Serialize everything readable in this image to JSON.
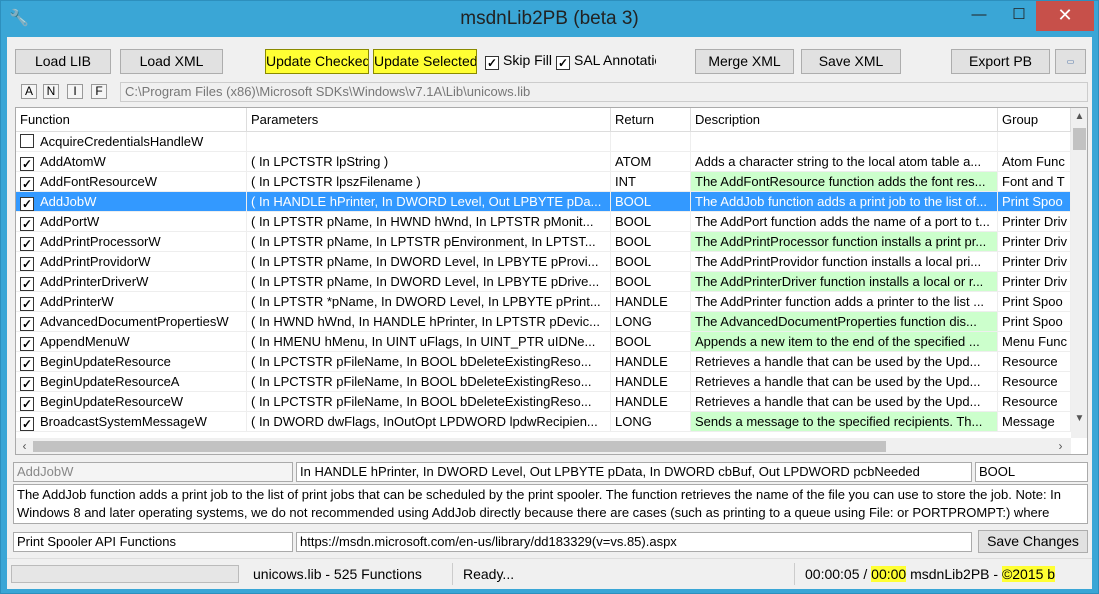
{
  "window": {
    "title": "msdnLib2PB (beta 3)",
    "min_glyph": "—",
    "max_glyph": "☐",
    "close_glyph": "✕"
  },
  "toolbar": {
    "load_lib": "Load LIB",
    "load_xml": "Load XML",
    "update_checked": "Update Checked",
    "update_selected": "Update Selected",
    "skip_fill": "Skip Fill",
    "sal_annotations": "SAL Annotatic",
    "merge_xml": "Merge XML",
    "save_xml": "Save XML",
    "export_pb": "Export PB",
    "highlight_color": "#ffff33"
  },
  "filters": [
    "A",
    "N",
    "I",
    "F"
  ],
  "path": "C:\\Program Files (x86)\\Microsoft SDKs\\Windows\\v7.1A\\Lib\\unicows.lib",
  "grid": {
    "columns": [
      "Function",
      "Parameters",
      "Return",
      "Description",
      "Group"
    ],
    "rows": [
      {
        "checked": false,
        "function": "AcquireCredentialsHandleW",
        "params": "",
        "ret": "",
        "desc": "",
        "group": "",
        "green": false,
        "selected": false
      },
      {
        "checked": true,
        "function": "AddAtomW",
        "params": "( In LPCTSTR lpString )",
        "ret": "ATOM",
        "desc": "Adds a character string to the local atom table a...",
        "group": "Atom Func",
        "green": false,
        "selected": false
      },
      {
        "checked": true,
        "function": "AddFontResourceW",
        "params": "( In LPCTSTR lpszFilename )",
        "ret": "INT",
        "desc": "The AddFontResource function adds the font res...",
        "group": "Font and T",
        "green": true,
        "selected": false
      },
      {
        "checked": true,
        "function": "AddJobW",
        "params": "( In HANDLE hPrinter, In DWORD Level, Out LPBYTE pDa...",
        "ret": "BOOL",
        "desc": "The AddJob function adds a print job to the list of...",
        "group": "Print Spoo",
        "green": true,
        "selected": true
      },
      {
        "checked": true,
        "function": "AddPortW",
        "params": "( In LPTSTR pName, In HWND hWnd, In LPTSTR pMonit...",
        "ret": "BOOL",
        "desc": "The AddPort function adds the name of a port to t...",
        "group": "Printer Driv",
        "green": false,
        "selected": false
      },
      {
        "checked": true,
        "function": "AddPrintProcessorW",
        "params": "( In LPTSTR pName, In LPTSTR pEnvironment, In LPTST...",
        "ret": "BOOL",
        "desc": "The AddPrintProcessor function installs a print pr...",
        "group": "Printer Driv",
        "green": true,
        "selected": false
      },
      {
        "checked": true,
        "function": "AddPrintProvidorW",
        "params": "( In LPTSTR pName, In DWORD Level, In LPBYTE pProvi...",
        "ret": "BOOL",
        "desc": "The AddPrintProvidor function installs a local pri...",
        "group": "Printer Driv",
        "green": false,
        "selected": false
      },
      {
        "checked": true,
        "function": "AddPrinterDriverW",
        "params": "( In LPTSTR pName, In DWORD Level, In LPBYTE pDrive...",
        "ret": "BOOL",
        "desc": "The AddPrinterDriver function installs a local or r...",
        "group": "Printer Driv",
        "green": true,
        "selected": false
      },
      {
        "checked": true,
        "function": "AddPrinterW",
        "params": "( In LPTSTR *pName, In DWORD Level, In LPBYTE pPrint...",
        "ret": "HANDLE",
        "desc": "The AddPrinter function adds a printer to the list ...",
        "group": "Print Spoo",
        "green": false,
        "selected": false
      },
      {
        "checked": true,
        "function": "AdvancedDocumentPropertiesW",
        "params": "( In HWND hWnd, In HANDLE hPrinter, In LPTSTR pDevic...",
        "ret": "LONG",
        "desc": "The AdvancedDocumentProperties function dis...",
        "group": "Print Spoo",
        "green": true,
        "selected": false
      },
      {
        "checked": true,
        "function": "AppendMenuW",
        "params": "( In HMENU hMenu, In UINT uFlags, In UINT_PTR uIDNe...",
        "ret": "BOOL",
        "desc": "Appends a new item to the end of the specified ...",
        "group": "Menu Func",
        "green": true,
        "selected": false
      },
      {
        "checked": true,
        "function": "BeginUpdateResource",
        "params": "( In LPCTSTR pFileName, In BOOL bDeleteExistingReso...",
        "ret": "HANDLE",
        "desc": "Retrieves a handle that can be used by the Upd...",
        "group": "Resource",
        "green": false,
        "selected": false
      },
      {
        "checked": true,
        "function": "BeginUpdateResourceA",
        "params": "( In LPCTSTR pFileName, In BOOL bDeleteExistingReso...",
        "ret": "HANDLE",
        "desc": "Retrieves a handle that can be used by the Upd...",
        "group": "Resource",
        "green": false,
        "selected": false
      },
      {
        "checked": true,
        "function": "BeginUpdateResourceW",
        "params": "( In LPCTSTR pFileName, In BOOL bDeleteExistingReso...",
        "ret": "HANDLE",
        "desc": "Retrieves a handle that can be used by the Upd...",
        "group": "Resource",
        "green": false,
        "selected": false
      },
      {
        "checked": true,
        "function": "BroadcastSystemMessageW",
        "params": "( In DWORD dwFlags, InOutOpt LPDWORD lpdwRecipien...",
        "ret": "LONG",
        "desc": "Sends a message to the specified recipients. Th...",
        "group": "Message",
        "green": true,
        "selected": false
      }
    ]
  },
  "detail": {
    "function": "AddJobW",
    "params": "In HANDLE hPrinter, In DWORD Level, Out LPBYTE pData, In DWORD cbBuf, Out LPDWORD pcbNeeded",
    "ret": "BOOL",
    "description": "The AddJob function adds a print job to the list of print jobs that can be scheduled by the print spooler. The function retrieves the name of the file you can use to store the job. Note: In Windows 8 and later operating systems, we do not recommended using AddJob directly because there are cases (such as printing to a queue using File: or PORTPROMPT:) where",
    "group": "Print Spooler API Functions",
    "url": "https://msdn.microsoft.com/en-us/library/dd183329(v=vs.85).aspx",
    "save_changes": "Save Changes"
  },
  "status": {
    "lib_info": "unicows.lib  -  525 Functions",
    "state": "Ready...",
    "time1": "00:00:05 /",
    "time2": "00:00",
    "app": "msdnLib2PB -",
    "copyright": "©2015 b"
  }
}
